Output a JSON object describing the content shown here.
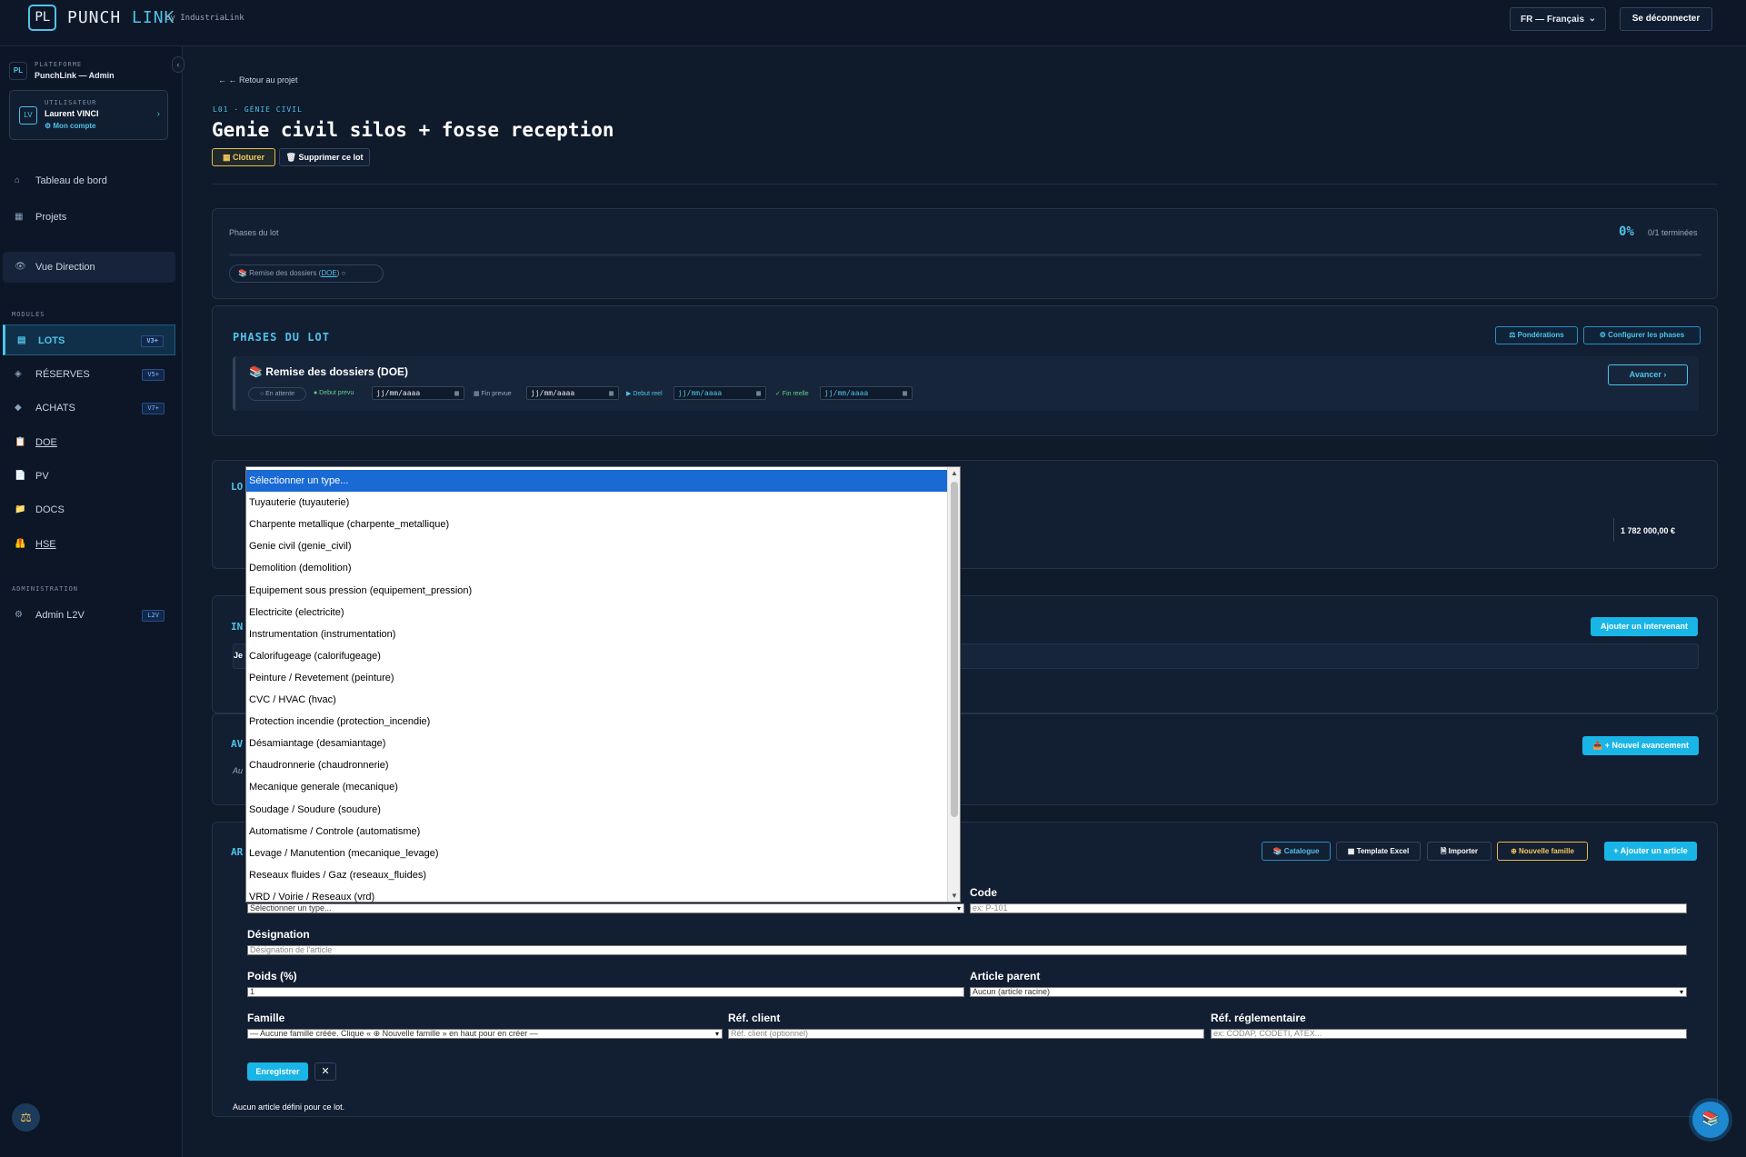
{
  "header": {
    "logo": "PL",
    "brand_left": "PUNCH",
    "brand_right": "LINK",
    "by": "by IndustriaLink",
    "language": "FR — Français",
    "logout": "Se déconnecter"
  },
  "sidebar": {
    "platform_label": "PLATEFORME",
    "platform_name": "PunchLink — Admin",
    "platform_icon": "PL",
    "user_label": "UTILISATEUR",
    "user_name": "Laurent VINCI",
    "user_initials": "LV",
    "user_link": "⚙ Mon compte",
    "nav_top": [
      {
        "label": "Tableau de bord",
        "icon": "⌂"
      },
      {
        "label": "Projets",
        "icon": "▦"
      }
    ],
    "nav_direction": {
      "label": "Vue Direction",
      "icon": "👁"
    },
    "modules_label": "MODULES",
    "modules": [
      {
        "label": "LOTS",
        "icon": "▤",
        "badge": "V3+"
      },
      {
        "label": "RÉSERVES",
        "icon": "◈",
        "badge": "V5+"
      },
      {
        "label": "ACHATS",
        "icon": "◆",
        "badge": "V7+"
      },
      {
        "label": "DOE",
        "icon": "📋",
        "badge": ""
      },
      {
        "label": "PV",
        "icon": "📄",
        "badge": ""
      },
      {
        "label": "DOCS",
        "icon": "📁",
        "badge": ""
      },
      {
        "label": "HSE",
        "icon": "🦺",
        "badge": ""
      }
    ],
    "admin_label": "ADMINISTRATION",
    "admin_item": {
      "label": "Admin L2V",
      "icon": "⚙",
      "badge": "L2V"
    },
    "bottom_icon": "⚖"
  },
  "page": {
    "back": "← ← Retour au projet",
    "lot_code": "L01 · GÉNIE CIVIL",
    "title": "Genie civil silos + fosse reception",
    "btn_cloturer": "▦ Cloturer",
    "btn_supprimer": "🗑 Supprimer ce lot"
  },
  "phases_summary": {
    "label": "Phases du lot",
    "percent": "0%",
    "completed": "0/1 terminées",
    "progress": 0,
    "chip_prefix": "📚 Remise des dossiers (",
    "chip_doe": "DOE",
    "chip_suffix": ") ○"
  },
  "phases": {
    "title": "PHASES DU LOT",
    "btn_ponderations": "⚖ Pondérations",
    "btn_configurer": "⚙ Configurer les phases",
    "phase_icon": "📚",
    "phase_title": "Remise des dossiers (DOE)",
    "status": "○ En attente",
    "debut_prevu": "● Debut prevu",
    "fin_prevue": "▦ Fin prevue",
    "debut_reel": "▶ Debut reel",
    "fin_reelle": "✓ Fin reelle",
    "date_ph": "jj/mm/aaaa",
    "btn_avancer": "Avancer ›"
  },
  "budget": {
    "title_fragment": "LO",
    "amount": "1 782 000,00 €"
  },
  "intervenants": {
    "title_fragment": "IN",
    "row_fragment": "Je",
    "btn_add": "Ajouter un intervenant"
  },
  "avancement": {
    "title_fragment": "AV",
    "sub_fragment": "Au",
    "btn_new": "📥 + Nouvel avancement"
  },
  "articles": {
    "title_fragment": "AR",
    "btn_catalogue": "📚 Catalogue",
    "btn_template": "▦ Template Excel",
    "btn_importer": "🗎 Importer",
    "btn_famille": "⊕ Nouvelle famille",
    "btn_ajouter": "+ Ajouter un article",
    "type_value": "Sélectionner un type...",
    "code_label": "Code",
    "code_ph": "ex: P-101",
    "designation_label": "Désignation",
    "designation_ph": "Désignation de l'article",
    "poids_label": "Poids (%)",
    "poids_value": "1",
    "parent_label": "Article parent",
    "parent_value": "Aucun (article racine)",
    "famille_label": "Famille",
    "famille_value": "— Aucune famille créée. Clique « ⊕ Nouvelle famille » en haut pour en créer —",
    "ref_client_label": "Réf. client",
    "ref_client_ph": "Réf. client (optionnel)",
    "ref_regl_label": "Réf. réglementaire",
    "ref_regl_ph": "ex: CODAP, CODETI, ATEX...",
    "btn_save": "Enregistrer",
    "btn_cancel": "✕",
    "empty": "Aucun article défini pour ce lot."
  },
  "type_dropdown": {
    "options": [
      "Sélectionner un type...",
      "Tuyauterie (tuyauterie)",
      "Charpente metallique (charpente_metallique)",
      "Genie civil (genie_civil)",
      "Demolition (demolition)",
      "Equipement sous pression (equipement_pression)",
      "Electricite (electricite)",
      "Instrumentation (instrumentation)",
      "Calorifugeage (calorifugeage)",
      "Peinture / Revetement (peinture)",
      "CVC / HVAC (hvac)",
      "Protection incendie (protection_incendie)",
      "Désamiantage (desamiantage)",
      "Chaudronnerie (chaudronnerie)",
      "Mecanique generale (mecanique)",
      "Soudage / Soudure (soudure)",
      "Automatisme / Controle (automatisme)",
      "Levage / Manutention (mecanique_levage)",
      "Reseaux fluides / Gaz (reseaux_fluides)",
      "VRD / Voirie / Reseaux (vrd)"
    ],
    "selected_index": 0
  },
  "fab_icon": "📚"
}
